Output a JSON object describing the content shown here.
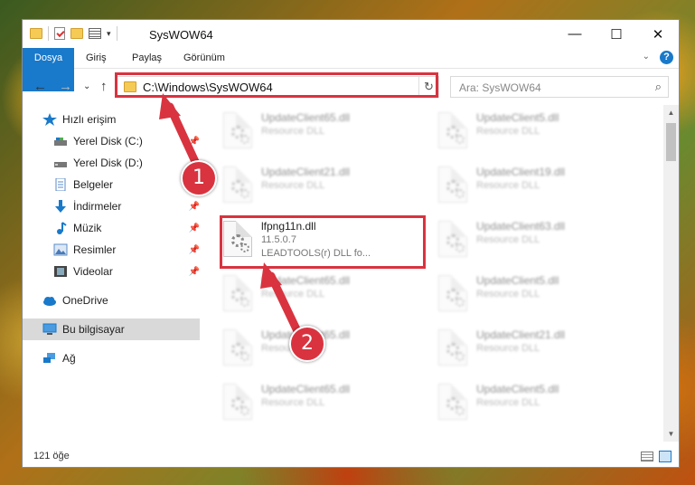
{
  "window": {
    "title": "SysWOW64"
  },
  "window_controls": {
    "minimize": "—",
    "maximize": "☐",
    "close": "✕"
  },
  "ribbon": {
    "tabs": [
      "Dosya",
      "Giriş",
      "Paylaş",
      "Görünüm"
    ],
    "expand": "⌄",
    "help": "?"
  },
  "nav": {
    "back": "←",
    "forward": "→",
    "recent": "⌄",
    "up": "↑",
    "address": "C:\\Windows\\SysWOW64",
    "refresh": "↻",
    "search_placeholder": "Ara: SysWOW64",
    "search_icon": "⌕"
  },
  "sidebar": {
    "items": [
      {
        "label": "Hızlı erişim",
        "icon": "star-icon"
      },
      {
        "label": "Yerel Disk (C:)",
        "icon": "drive-icon"
      },
      {
        "label": "Yerel Disk (D:)",
        "icon": "drive-icon"
      },
      {
        "label": "Belgeler",
        "icon": "document-icon"
      },
      {
        "label": "İndirmeler",
        "icon": "download-icon"
      },
      {
        "label": "Müzik",
        "icon": "music-icon"
      },
      {
        "label": "Resimler",
        "icon": "picture-icon"
      },
      {
        "label": "Videolar",
        "icon": "video-icon"
      },
      {
        "label": "OneDrive",
        "icon": "cloud-icon"
      },
      {
        "label": "Bu bilgisayar",
        "icon": "computer-icon"
      },
      {
        "label": "Ağ",
        "icon": "network-icon"
      }
    ],
    "pin": "📌"
  },
  "files": [
    {
      "name": "UpdateClient65.dll",
      "desc": "Resource DLL"
    },
    {
      "name": "UpdateClient5.dll",
      "desc": "Resource DLL"
    },
    {
      "name": "UpdateClient21.dll",
      "desc": "Resource DLL"
    },
    {
      "name": "UpdateClient19.dll",
      "desc": "Resource DLL"
    },
    {
      "name": "lfpng11n.dll",
      "version": "11.5.0.7",
      "desc": "LEADTOOLS(r) DLL fo..."
    },
    {
      "name": "UpdateClient63.dll",
      "desc": "Resource DLL"
    },
    {
      "name": "UpdateClient65.dll",
      "desc": "Resource DLL"
    },
    {
      "name": "UpdateClient5.dll",
      "desc": "Resource DLL"
    },
    {
      "name": "UpdateClient65.dll",
      "desc": "Resource DLL"
    },
    {
      "name": "UpdateClient21.dll",
      "desc": "Resource DLL"
    },
    {
      "name": "UpdateClient65.dll",
      "desc": "Resource DLL"
    },
    {
      "name": "UpdateClient5.dll",
      "desc": "Resource DLL"
    }
  ],
  "scrollbar": {
    "up": "▲",
    "down": "▼"
  },
  "status": {
    "count": "121 öğe"
  },
  "annotations": {
    "step1": "1",
    "step2": "2",
    "color": "#d9333f"
  }
}
